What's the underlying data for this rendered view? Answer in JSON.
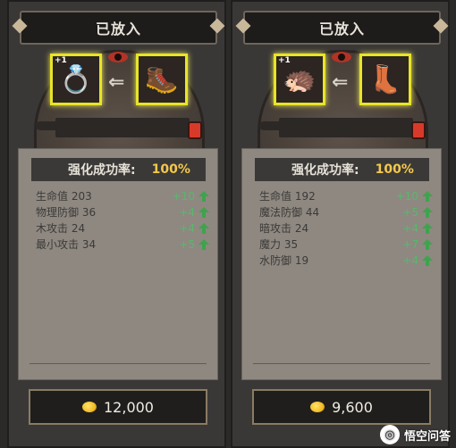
{
  "panels": [
    {
      "title": "已放入",
      "slots": [
        {
          "icon": "ring-icon",
          "glyph": "💍",
          "level": "+1"
        },
        {
          "icon": "gauntlet-icon",
          "glyph": "🥾",
          "level": ""
        }
      ],
      "success_rate_label": "强化成功率:",
      "success_rate_value": "100%",
      "stats": [
        {
          "name": "生命值 203",
          "bonus": "+10"
        },
        {
          "name": "物理防御 36",
          "bonus": "+4"
        },
        {
          "name": "木攻击 24",
          "bonus": "+4"
        },
        {
          "name": "最小攻击 34",
          "bonus": "+5"
        }
      ],
      "cost": "12,000"
    },
    {
      "title": "已放入",
      "slots": [
        {
          "icon": "spiked-helmet-icon",
          "glyph": "🦔",
          "level": "+1"
        },
        {
          "icon": "boots-icon",
          "glyph": "👢",
          "level": ""
        }
      ],
      "success_rate_label": "强化成功率:",
      "success_rate_value": "100%",
      "stats": [
        {
          "name": "生命值 192",
          "bonus": "+10"
        },
        {
          "name": "魔法防御 44",
          "bonus": "+5"
        },
        {
          "name": "暗攻击 24",
          "bonus": "+4"
        },
        {
          "name": "魔力 35",
          "bonus": "+7"
        },
        {
          "name": "水防御 19",
          "bonus": "+4"
        }
      ],
      "cost": "9,600"
    }
  ],
  "watermark": "悟空问答",
  "colors": {
    "accent_gold": "#f3c84c",
    "bonus_green": "#58b86b",
    "slot_highlight": "#e8e42a"
  }
}
